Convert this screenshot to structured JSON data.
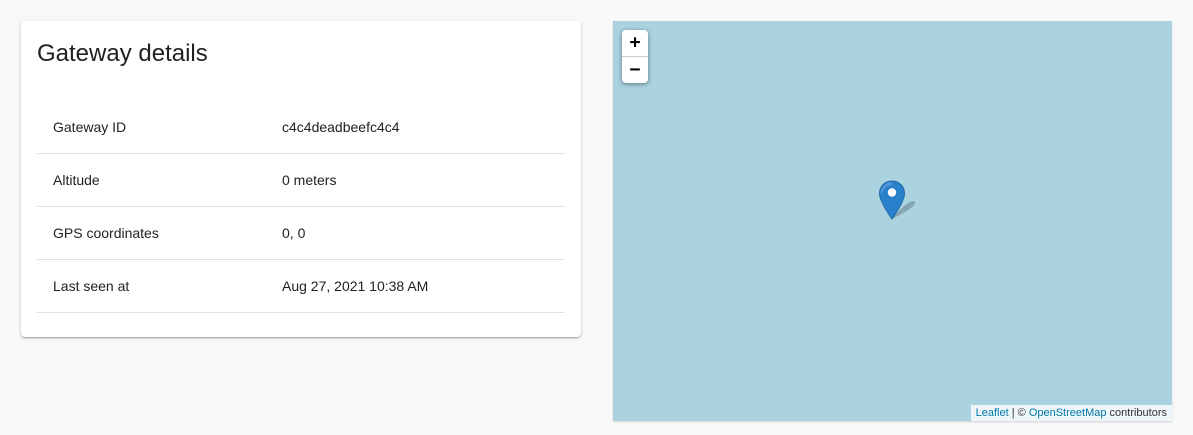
{
  "card": {
    "title": "Gateway details",
    "rows": [
      {
        "label": "Gateway ID",
        "value": "c4c4deadbeefc4c4"
      },
      {
        "label": "Altitude",
        "value": "0 meters"
      },
      {
        "label": "GPS coordinates",
        "value": "0, 0"
      },
      {
        "label": "Last seen at",
        "value": "Aug 27, 2021 10:38 AM"
      }
    ]
  },
  "map": {
    "zoom_in_label": "+",
    "zoom_out_label": "−",
    "marker_icon": "map-pin-icon",
    "attribution": {
      "leaflet": "Leaflet",
      "separator": " | © ",
      "osm": "OpenStreetMap",
      "suffix": " contributors"
    },
    "colors": {
      "water": "#aad3df",
      "marker": "#2a81cb"
    }
  }
}
